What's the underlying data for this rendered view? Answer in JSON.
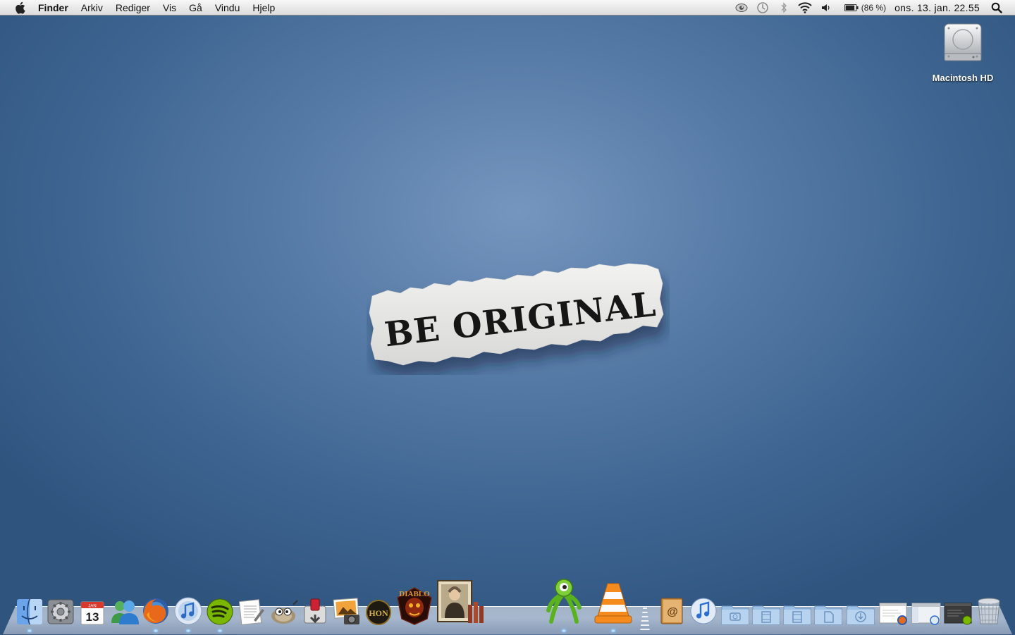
{
  "menubar": {
    "apple_icon": "apple-icon",
    "app_name": "Finder",
    "items": [
      "Arkiv",
      "Rediger",
      "Vis",
      "Gå",
      "Vindu",
      "Hjelp"
    ],
    "status": {
      "battery": "(86 %)",
      "clock": "ons. 13. jan.  22.55"
    }
  },
  "desktop": {
    "drive_label": "Macintosh HD",
    "wallpaper_text": "BE ORIGINAL"
  },
  "dock": {
    "calendar_month": "JAN",
    "calendar_day": "13",
    "diablo_label": "DIABLO",
    "hon_label": "HON"
  },
  "colors": {
    "desktop_center": "#7596bf",
    "desktop_edge": "#2f557f",
    "menubar": "#e8e8e8"
  }
}
